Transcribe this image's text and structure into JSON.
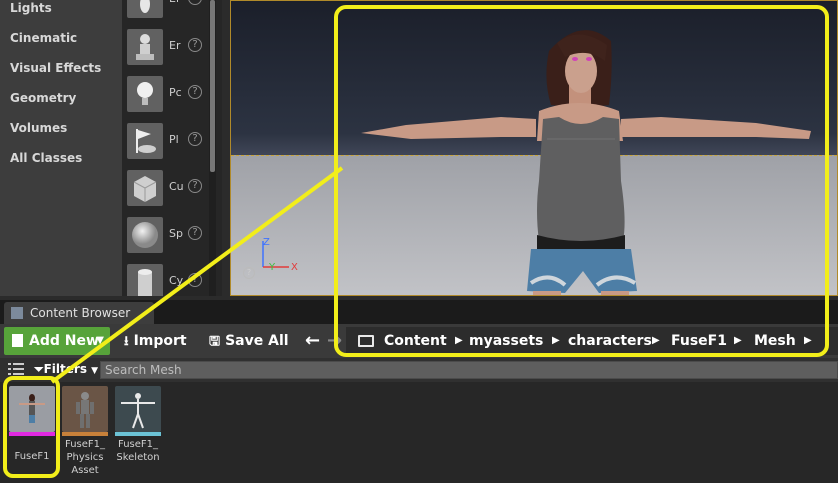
{
  "place_categories": [
    "Lights",
    "Cinematic",
    "Visual Effects",
    "Geometry",
    "Volumes",
    "All Classes"
  ],
  "place_items": [
    {
      "label": "Er",
      "icon": "mannequin-icon"
    },
    {
      "label": "Er",
      "icon": "pawn-icon"
    },
    {
      "label": "Pc",
      "icon": "lightbulb-icon"
    },
    {
      "label": "Pl",
      "icon": "player-start-icon"
    },
    {
      "label": "Cu",
      "icon": "cube-icon"
    },
    {
      "label": "Sp",
      "icon": "sphere-icon"
    },
    {
      "label": "Cy",
      "icon": "cylinder-icon"
    }
  ],
  "help_glyph": "?",
  "viewport": {
    "axis_z": "Z",
    "axis_y": "Y",
    "axis_x": "X"
  },
  "content_browser": {
    "tab_label": "Content Browser",
    "toolbar": {
      "add_new": "Add New",
      "import": "Import",
      "save_all": "Save All"
    },
    "breadcrumb": [
      "Content",
      "myassets",
      "characters",
      "FuseF1",
      "Mesh"
    ],
    "filters_label": "Filters",
    "search_placeholder": "Search Mesh",
    "assets": [
      {
        "name_lines": [
          "FuseF1"
        ],
        "bar_color": "#e02ae0"
      },
      {
        "name_lines": [
          "FuseF1_",
          "Physics",
          "Asset"
        ],
        "bar_color": "#c8813a"
      },
      {
        "name_lines": [
          "FuseF1_",
          "Skeleton"
        ],
        "bar_color": "#6cc3d6"
      }
    ]
  },
  "colors": {
    "highlight": "#f2ee1a",
    "add_new": "#57a33a"
  }
}
